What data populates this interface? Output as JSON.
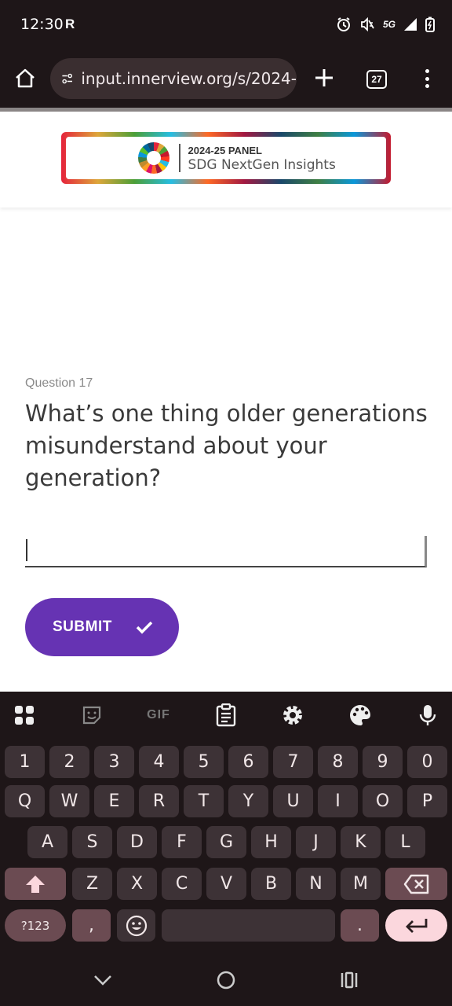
{
  "status_bar": {
    "time": "12:30",
    "r_indicator": "R",
    "network": "5G",
    "icons": [
      "alarm-icon",
      "mute-icon",
      "signal-icon",
      "battery-icon"
    ]
  },
  "browser": {
    "url": "input.innerview.org/s/2024-",
    "tab_count": "27"
  },
  "banner": {
    "year": "2024-25",
    "panel": "PANEL",
    "subtitle": "SDG NextGen Insights"
  },
  "question": {
    "number_label": "Question 17",
    "text": "What’s one thing older generations misunderstand about your generation?",
    "answer_value": ""
  },
  "submit": {
    "label": "SUBMIT"
  },
  "keyboard": {
    "toolbar": [
      "apps-icon",
      "sticker-icon",
      "GIF",
      "clipboard-icon",
      "settings-icon",
      "palette-icon",
      "mic-icon"
    ],
    "gif_label": "GIF",
    "row_numbers": [
      "1",
      "2",
      "3",
      "4",
      "5",
      "6",
      "7",
      "8",
      "9",
      "0"
    ],
    "row1": [
      "Q",
      "W",
      "E",
      "R",
      "T",
      "Y",
      "U",
      "I",
      "O",
      "P"
    ],
    "row2": [
      "A",
      "S",
      "D",
      "F",
      "G",
      "H",
      "J",
      "K",
      "L"
    ],
    "row3": [
      "Z",
      "X",
      "C",
      "V",
      "B",
      "N",
      "M"
    ],
    "sym_label": "?123",
    "comma": ",",
    "period": "."
  },
  "colors": {
    "accent": "#6633b3",
    "keyboard_bg": "#1e1618",
    "key_bg": "#3d3236",
    "mod_key_bg": "#6b4b52",
    "enter_key_bg": "#fbd7dd"
  }
}
